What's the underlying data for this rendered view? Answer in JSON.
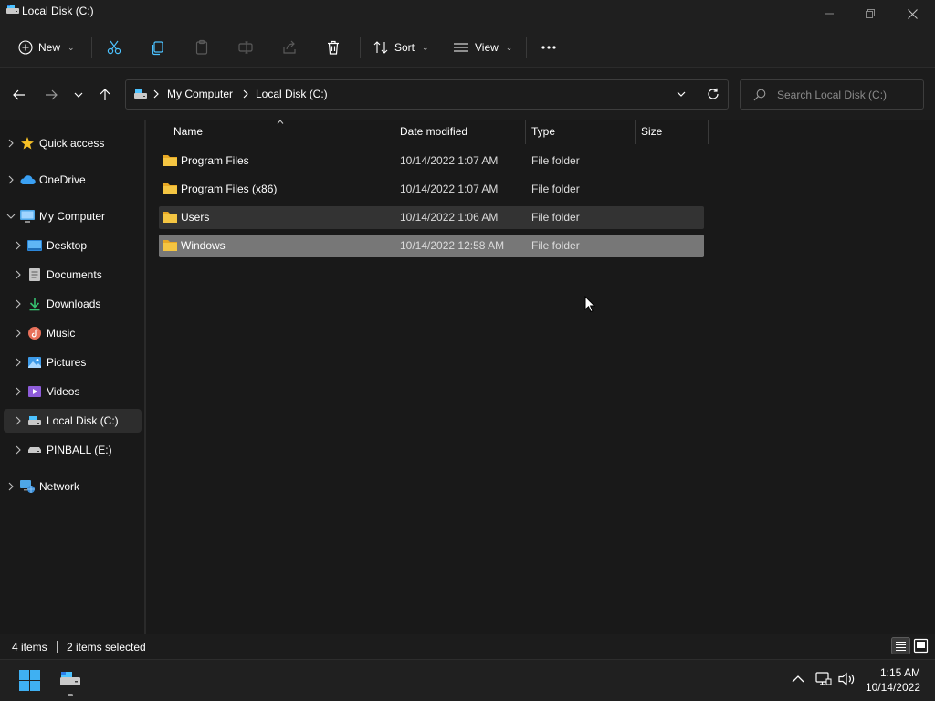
{
  "window": {
    "title": "Local Disk (C:)"
  },
  "commandbar": {
    "new_label": "New",
    "sort_label": "Sort",
    "view_label": "View"
  },
  "address": {
    "crumbs": [
      "My Computer",
      "Local Disk (C:)"
    ]
  },
  "search": {
    "placeholder": "Search Local Disk (C:)"
  },
  "sidebar": {
    "items": [
      {
        "label": "Quick access",
        "icon": "star-icon"
      },
      {
        "label": "OneDrive",
        "icon": "cloud-icon"
      },
      {
        "label": "My Computer",
        "icon": "computer-icon"
      },
      {
        "label": "Desktop",
        "icon": "desktop-icon"
      },
      {
        "label": "Documents",
        "icon": "documents-icon"
      },
      {
        "label": "Downloads",
        "icon": "download-icon"
      },
      {
        "label": "Music",
        "icon": "music-icon"
      },
      {
        "label": "Pictures",
        "icon": "pictures-icon"
      },
      {
        "label": "Videos",
        "icon": "videos-icon"
      },
      {
        "label": "Local Disk (C:)",
        "icon": "drive-icon"
      },
      {
        "label": "PINBALL (E:)",
        "icon": "removable-drive-icon"
      },
      {
        "label": "Network",
        "icon": "network-icon"
      }
    ]
  },
  "filelist": {
    "columns": [
      "Name",
      "Date modified",
      "Type",
      "Size"
    ],
    "rows": [
      {
        "name": "Program Files",
        "date": "10/14/2022 1:07 AM",
        "type": "File folder",
        "size": ""
      },
      {
        "name": "Program Files (x86)",
        "date": "10/14/2022 1:07 AM",
        "type": "File folder",
        "size": ""
      },
      {
        "name": "Users",
        "date": "10/14/2022 1:06 AM",
        "type": "File folder",
        "size": ""
      },
      {
        "name": "Windows",
        "date": "10/14/2022 12:58 AM",
        "type": "File folder",
        "size": ""
      }
    ]
  },
  "status": {
    "item_count": "4 items",
    "selected": "2 items selected"
  },
  "taskbar": {
    "time": "1:15 AM",
    "date": "10/14/2022"
  },
  "colors": {
    "folder": "#f4c542",
    "accent": "#4cc2ff",
    "selected_row": "#777777"
  }
}
